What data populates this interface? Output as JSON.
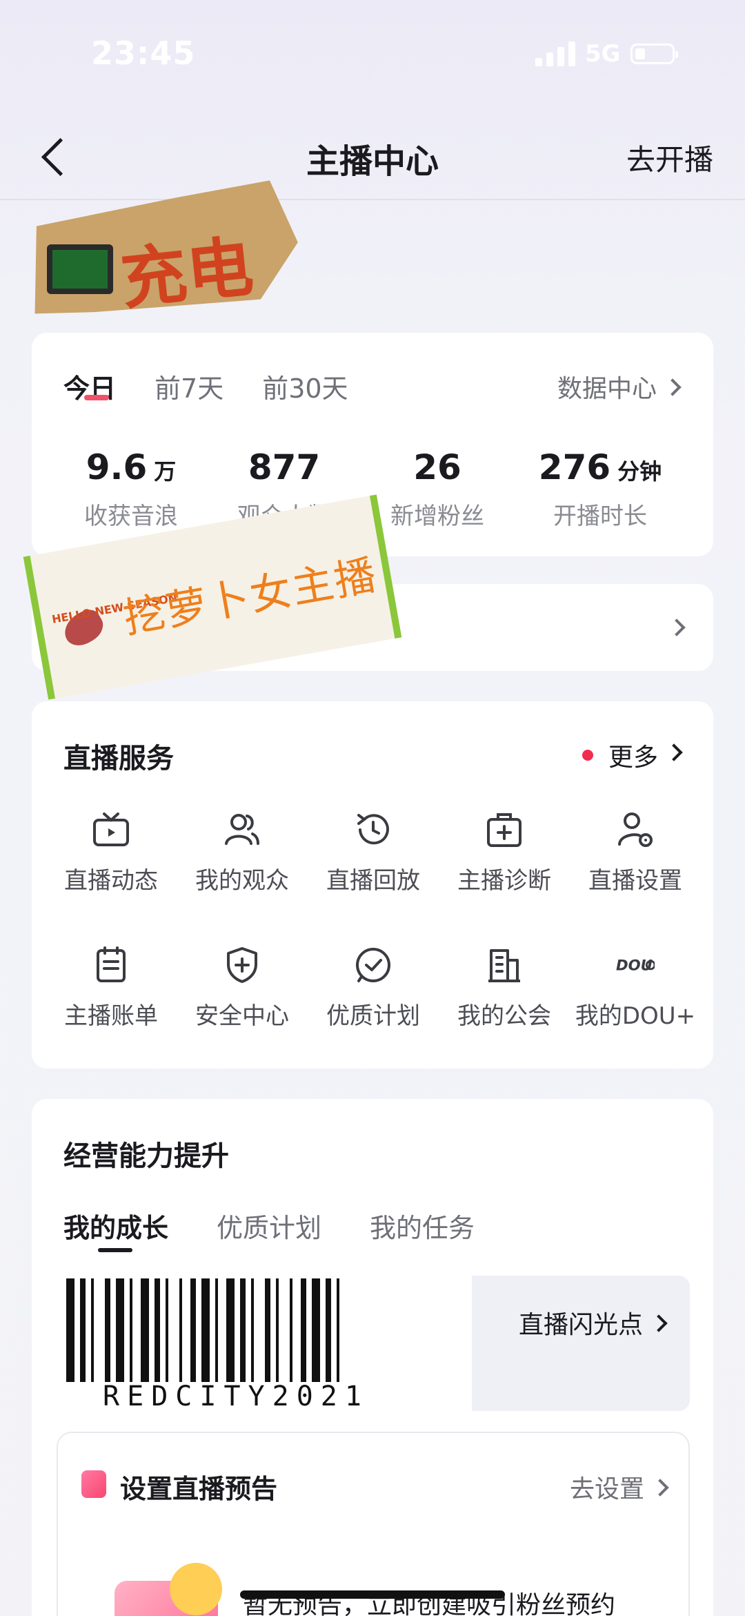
{
  "status_bar": {
    "time": "23:45",
    "network": "5G"
  },
  "nav": {
    "title": "主播中心",
    "action": "去开播"
  },
  "sticker_top": {
    "text": "充电"
  },
  "stats": {
    "tabs": [
      "今日",
      "前7天",
      "前30天"
    ],
    "data_center": "数据中心",
    "items": [
      {
        "value": "9.6",
        "unit": "万",
        "label": "收获音浪"
      },
      {
        "value": "877",
        "unit": "",
        "label": "观众人数"
      },
      {
        "value": "26",
        "unit": "",
        "label": "新增粉丝"
      },
      {
        "value": "276",
        "unit": "分钟",
        "label": "开播时长"
      }
    ]
  },
  "sticker_mid": {
    "text": "挖萝卜女主播",
    "small": "HELLO NEW SEASON"
  },
  "live_services": {
    "title": "直播服务",
    "more": "更多",
    "items": [
      {
        "label": "直播动态",
        "icon": "tv-icon"
      },
      {
        "label": "我的观众",
        "icon": "audience-icon"
      },
      {
        "label": "直播回放",
        "icon": "replay-icon"
      },
      {
        "label": "主播诊断",
        "icon": "diagnosis-icon"
      },
      {
        "label": "直播设置",
        "icon": "user-settings-icon"
      },
      {
        "label": "主播账单",
        "icon": "bill-icon"
      },
      {
        "label": "安全中心",
        "icon": "shield-icon"
      },
      {
        "label": "优质计划",
        "icon": "check-circle-icon"
      },
      {
        "label": "我的公会",
        "icon": "building-icon"
      },
      {
        "label": "我的DOU+",
        "icon": "dou-icon"
      }
    ]
  },
  "business": {
    "title": "经营能力提升",
    "tabs": [
      "我的成长",
      "优质计划",
      "我的任务"
    ],
    "flash": "直播闪光点",
    "barcode_text": "REDCITY2021"
  },
  "preview": {
    "title": "设置直播预告",
    "action": "去设置",
    "desc": "暂无预告，立即创建吸引粉丝预约"
  }
}
